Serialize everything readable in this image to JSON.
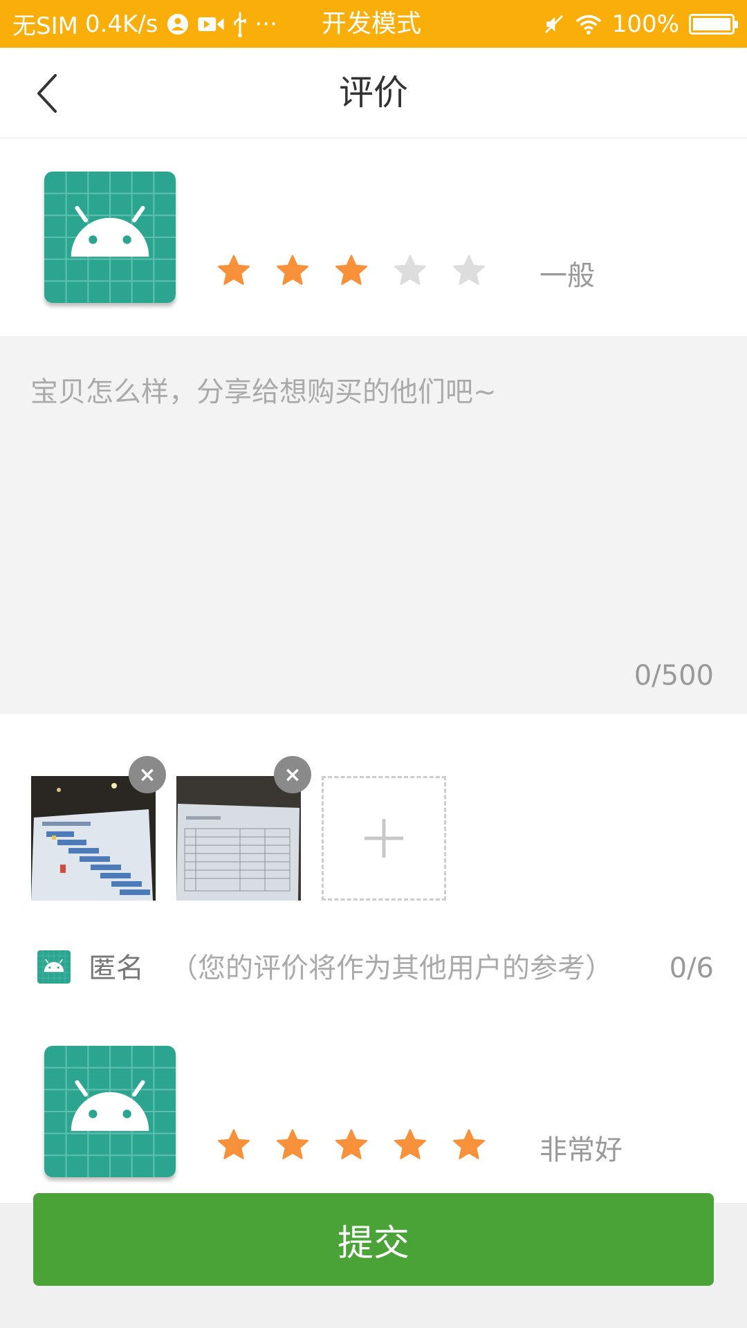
{
  "status_bar": {
    "carrier": "无SIM",
    "speed": "0.4K/s",
    "more": "···",
    "mode": "开发模式",
    "battery": "100%"
  },
  "header": {
    "title": "评价"
  },
  "rating_primary": {
    "stars_filled": 3,
    "stars_total": 5,
    "label": "一般"
  },
  "review": {
    "placeholder": "宝贝怎么样，分享给想购买的他们吧~",
    "counter": "0/500"
  },
  "photos": {
    "remove_symbol": "×",
    "count": 2
  },
  "anonymous": {
    "label": "匿名",
    "hint": "（您的评价将作为其他用户的参考）",
    "count": "0/6"
  },
  "rating_secondary": {
    "stars_filled": 5,
    "stars_total": 5,
    "label": "非常好"
  },
  "submit": {
    "label": "提交"
  },
  "colors": {
    "status_bar": "#F9AE0A",
    "star_active": "#F9913A",
    "star_inactive": "#DDDDDD",
    "submit": "#4AA337",
    "icon_bg": "#2BA58F"
  }
}
